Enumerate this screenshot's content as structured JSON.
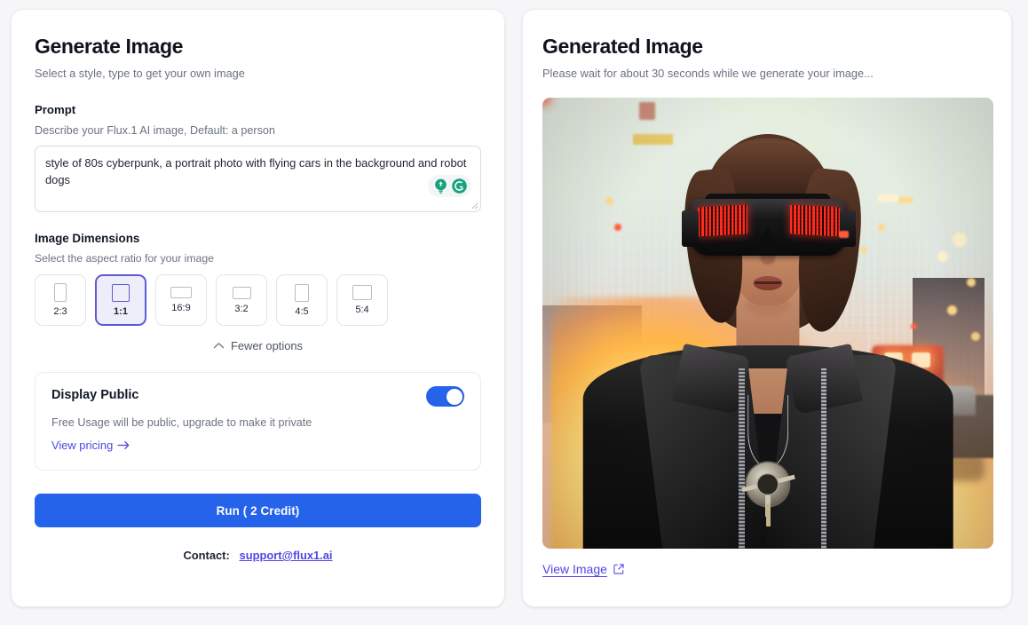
{
  "left_panel": {
    "title": "Generate Image",
    "subtitle": "Select a style, type to get your own image",
    "prompt": {
      "label": "Prompt",
      "help": "Describe your Flux.1 AI image, Default: a person",
      "value": "style of 80s cyberpunk, a portrait photo with flying cars in the background and robot dogs",
      "placeholder": "a person",
      "assistant_icons": [
        "lightbulb-icon",
        "grammarly-icon"
      ]
    },
    "dimensions": {
      "label": "Image Dimensions",
      "help": "Select the aspect ratio for your image",
      "selected": "1:1",
      "options": [
        {
          "label": "2:3",
          "w": 14,
          "h": 21
        },
        {
          "label": "1:1",
          "w": 20,
          "h": 20
        },
        {
          "label": "16:9",
          "w": 24,
          "h": 13.5
        },
        {
          "label": "3:2",
          "w": 21,
          "h": 14
        },
        {
          "label": "4:5",
          "w": 16,
          "h": 20
        },
        {
          "label": "5:4",
          "w": 22,
          "h": 17.6
        }
      ],
      "toggle_options_label": "Fewer options",
      "toggle_options_icon": "chevron-up-icon"
    },
    "display_public": {
      "title": "Display Public",
      "description": "Free Usage will be public, upgrade to make it private",
      "link_label": "View pricing",
      "link_icon": "arrow-right-icon",
      "toggle_on": true
    },
    "run_button": "Run   ( 2 Credit)",
    "contact_label": "Contact:",
    "contact_email": "support@flux1.ai"
  },
  "right_panel": {
    "title": "Generated Image",
    "subtitle": "Please wait for about 30 seconds while we generate your image...",
    "view_image_label": "View Image",
    "view_image_icon": "external-link-icon",
    "image_alt": "80s cyberpunk portrait of a woman wearing black LED visor goggles and a leather jacket with flying cars and city skyscrapers in the background"
  },
  "colors": {
    "primary_blue": "#2563eb",
    "accent_indigo": "#4f46e5",
    "selected_tile_border": "#5b5bd6",
    "selected_tile_fill": "#eeeefb",
    "page_background": "#f6f6f8",
    "card_background": "#ffffff",
    "muted_text": "#6b7280",
    "grammarly_green": "#15a47e"
  }
}
